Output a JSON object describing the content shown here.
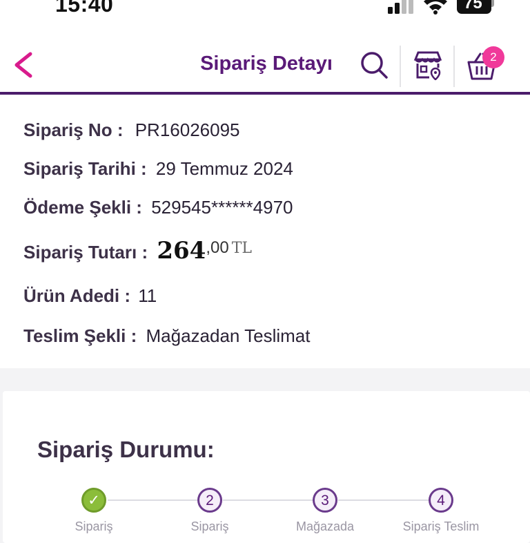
{
  "status_bar": {
    "time": "15:40",
    "battery": "75"
  },
  "header": {
    "title": "Sipariş Detayı",
    "back_icon": "chevron-left-icon",
    "search_icon": "search-icon",
    "store_icon": "store-location-icon",
    "cart_icon": "basket-icon",
    "cart_count": "2",
    "accent": "#5a1a78"
  },
  "order": {
    "no_label": "Sipariş No :",
    "no_value": "PR16026095",
    "date_label": "Sipariş Tarihi :",
    "date_value": "29 Temmuz 2024",
    "payment_label": "Ödeme Şekli :",
    "payment_value": "529545******4970",
    "amount_label": "Sipariş Tutarı :",
    "amount_int": "264",
    "amount_dec": ",00",
    "amount_currency": "TL",
    "qty_label": "Ürün Adedi :",
    "qty_value": "11",
    "delivery_label": "Teslim Şekli :",
    "delivery_value": "Mağazadan Teslimat"
  },
  "status": {
    "title": "Sipariş Durumu:",
    "steps": [
      {
        "number": "✓",
        "label": "Sipariş",
        "state": "done"
      },
      {
        "number": "2",
        "label": "Sipariş",
        "state": "todo"
      },
      {
        "number": "3",
        "label": "Mağazada",
        "state": "todo"
      },
      {
        "number": "4",
        "label": "Sipariş Teslim",
        "state": "todo"
      }
    ],
    "done_color": "#8bbd3a"
  }
}
